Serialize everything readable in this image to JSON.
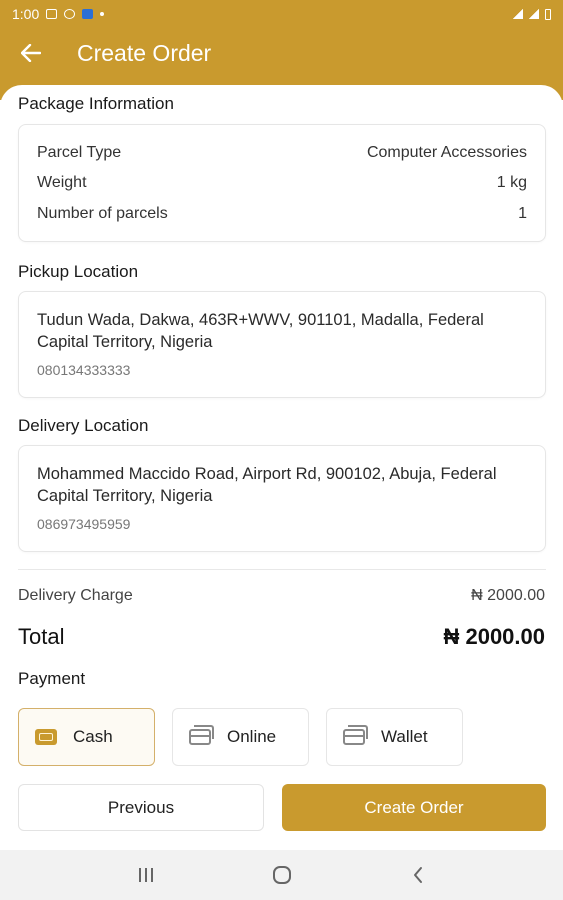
{
  "status_bar": {
    "time": "1:00"
  },
  "app_bar": {
    "title": "Create Order"
  },
  "package": {
    "section_title": "Package Information",
    "rows": [
      {
        "label": "Parcel Type",
        "value": "Computer Accessories"
      },
      {
        "label": "Weight",
        "value": "1 kg"
      },
      {
        "label": "Number of parcels",
        "value": "1"
      }
    ]
  },
  "pickup": {
    "section_title": "Pickup Location",
    "address": "Tudun Wada, Dakwa, 463R+WWV, 901101, Madalla, Federal Capital Territory, Nigeria",
    "phone": "080134333333"
  },
  "delivery": {
    "section_title": "Delivery Location",
    "address": "Mohammed Maccido Road, Airport Rd, 900102, Abuja, Federal Capital Territory, Nigeria",
    "phone": "086973495959"
  },
  "charges": {
    "delivery_label": "Delivery Charge",
    "delivery_value": "₦ 2000.00",
    "total_label": "Total",
    "total_value": "₦ 2000.00"
  },
  "payment": {
    "section_title": "Payment",
    "options": [
      {
        "label": "Cash",
        "icon": "cash-icon",
        "selected": true
      },
      {
        "label": "Online",
        "icon": "card-icon",
        "selected": false
      },
      {
        "label": "Wallet",
        "icon": "wallet-icon",
        "selected": false
      }
    ]
  },
  "actions": {
    "previous_label": "Previous",
    "create_label": "Create Order"
  },
  "colors": {
    "accent": "#c99a2e",
    "background": "#ffffff"
  }
}
